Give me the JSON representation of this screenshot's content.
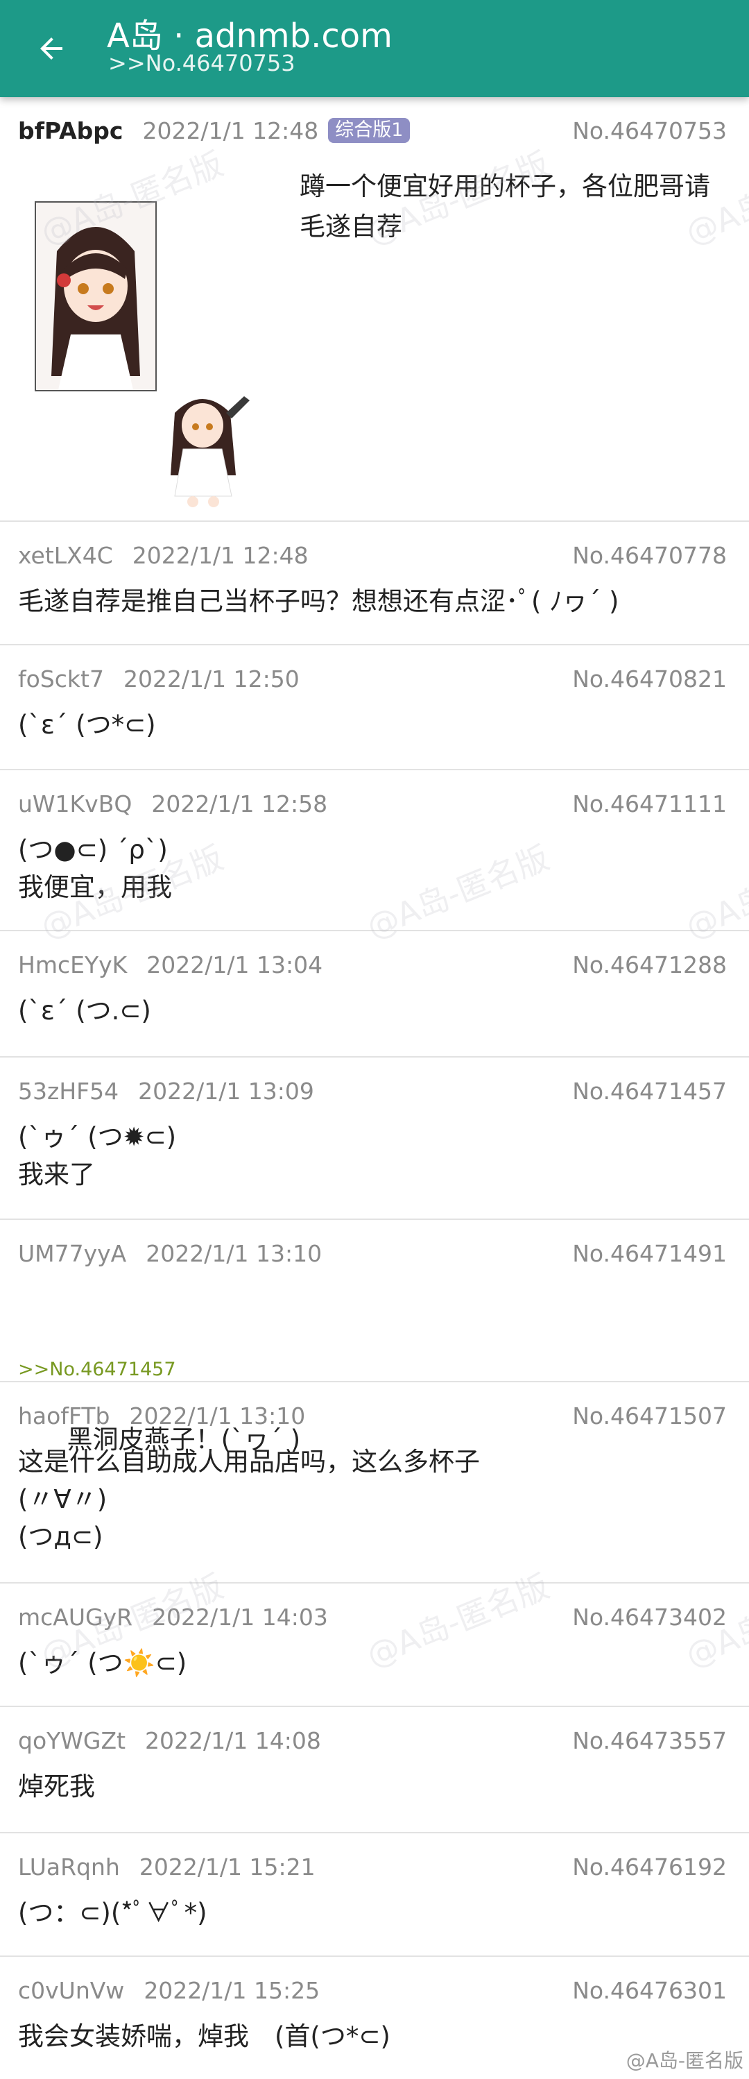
{
  "appbar": {
    "title": "A岛 · adnmb.com",
    "subtitle": ">>No.46470753"
  },
  "colors": {
    "appbar": "#1d9a88",
    "tag": "#8e8ec4",
    "quote": "#789922",
    "meta": "#8a8a8a"
  },
  "op": {
    "uid": "bfPAbpc",
    "time": "2022/1/1 12:48",
    "tag": "综合版1",
    "no": "No.46470753",
    "content": "蹲一个便宜好用的杯子，各位肥哥请\n毛遂自荐"
  },
  "replies": [
    {
      "uid": "xetLX4C",
      "time": "2022/1/1 12:48",
      "no": "No.46470778",
      "content": "毛遂自荐是推自己当杯子吗？想想还有点涩･ﾟ( ﾉヮ´ )"
    },
    {
      "uid": "foSckt7",
      "time": "2022/1/1 12:50",
      "no": "No.46470821",
      "content": "(`ε´ (つ*⊂)"
    },
    {
      "uid": "uW1KvBQ",
      "time": "2022/1/1 12:58",
      "no": "No.46471111",
      "content": "(つ●⊂) ´ρ`)\n我便宜，用我"
    },
    {
      "uid": "HmcEYyK",
      "time": "2022/1/1 13:04",
      "no": "No.46471288",
      "content": "(`ε´ (つ.⊂)"
    },
    {
      "uid": "53zHF54",
      "time": "2022/1/1 13:09",
      "no": "No.46471457",
      "content": "(`ゥ´ (つ✹⊂)\n我来了"
    },
    {
      "uid": "UM77yyA",
      "time": "2022/1/1 13:10",
      "no": "No.46471491",
      "quote": ">>No.46471457",
      "content": "黑洞皮燕子！(`ヮ´ )"
    },
    {
      "uid": "haofFTb",
      "time": "2022/1/1 13:10",
      "no": "No.46471507",
      "content": "这是什么自助成人用品店吗，这么多杯子\n(〃∀〃)\n(つд⊂)"
    },
    {
      "uid": "mcAUGyR",
      "time": "2022/1/1 14:03",
      "no": "No.46473402",
      "content": "(`ゥ´ (つ☀️⊂)"
    },
    {
      "uid": "qoYWGZt",
      "time": "2022/1/1 14:08",
      "no": "No.46473557",
      "content": "焯死我"
    },
    {
      "uid": "LUaRqnh",
      "time": "2022/1/1 15:21",
      "no": "No.46476192",
      "content": "(つ：⊂)(*ﾟ∀ﾟ*)"
    },
    {
      "uid": "c0vUnVw",
      "time": "2022/1/1 15:25",
      "no": "No.46476301",
      "content": "我会女装娇喘，焯我　(首(つ*⊂)"
    }
  ],
  "watermark": {
    "text": "@A岛-匿名版",
    "corner": "@A岛-匿名版"
  }
}
